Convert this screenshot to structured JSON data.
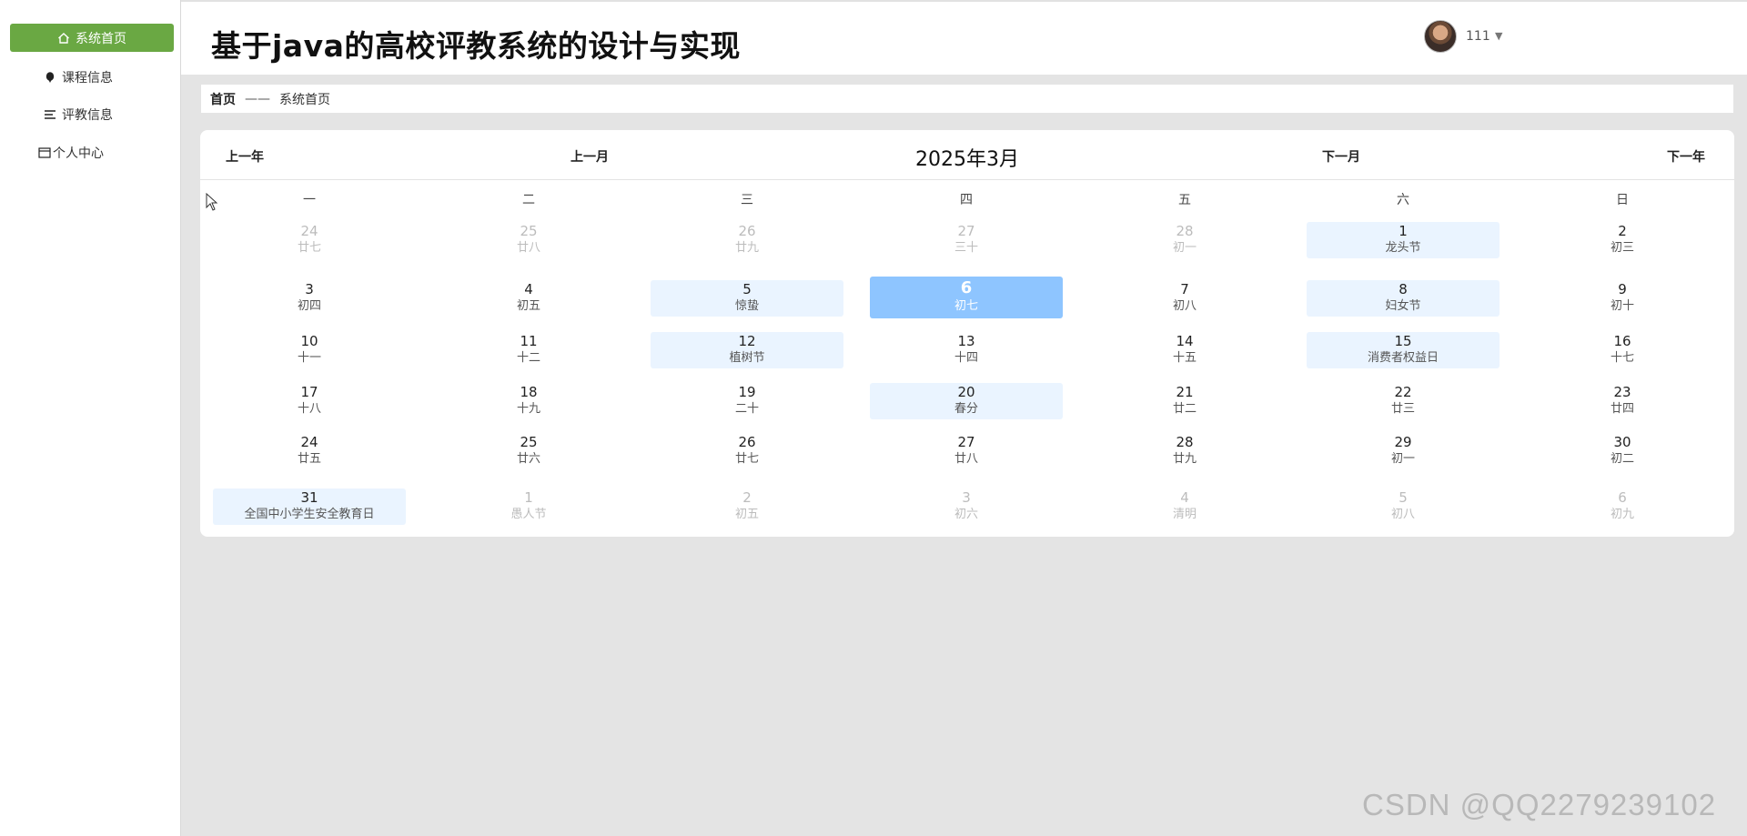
{
  "app": {
    "title": "基于java的高校评教系统的设计与实现"
  },
  "sidebar": {
    "items": [
      {
        "label": "系统首页",
        "icon": "home-icon"
      },
      {
        "label": "课程信息",
        "icon": "pin-icon"
      },
      {
        "label": "评教信息",
        "icon": "list-icon"
      },
      {
        "label": "个人中心",
        "icon": "card-icon"
      }
    ]
  },
  "header": {
    "username": "111",
    "caret": "▼"
  },
  "breadcrumb": {
    "home": "首页",
    "separator": "——",
    "current": "系统首页"
  },
  "calendar": {
    "prev_year": "上一年",
    "prev_month": "上一月",
    "title": "2025年3月",
    "next_month": "下一月",
    "next_year": "下一年",
    "weekdays": [
      "一",
      "二",
      "三",
      "四",
      "五",
      "六",
      "日"
    ],
    "weeks": [
      [
        {
          "d": "24",
          "l": "廿七",
          "type": "other"
        },
        {
          "d": "25",
          "l": "廿八",
          "type": "other"
        },
        {
          "d": "26",
          "l": "廿九",
          "type": "other"
        },
        {
          "d": "27",
          "l": "三十",
          "type": "other"
        },
        {
          "d": "28",
          "l": "初一",
          "type": "other"
        },
        {
          "d": "1",
          "l": "龙头节",
          "type": "fest"
        },
        {
          "d": "2",
          "l": "初三",
          "type": "normal"
        }
      ],
      [
        {
          "d": "3",
          "l": "初四",
          "type": "normal"
        },
        {
          "d": "4",
          "l": "初五",
          "type": "normal"
        },
        {
          "d": "5",
          "l": "惊蛰",
          "type": "fest"
        },
        {
          "d": "6",
          "l": "初七",
          "type": "today"
        },
        {
          "d": "7",
          "l": "初八",
          "type": "normal"
        },
        {
          "d": "8",
          "l": "妇女节",
          "type": "fest"
        },
        {
          "d": "9",
          "l": "初十",
          "type": "normal"
        }
      ],
      [
        {
          "d": "10",
          "l": "十一",
          "type": "normal"
        },
        {
          "d": "11",
          "l": "十二",
          "type": "normal"
        },
        {
          "d": "12",
          "l": "植树节",
          "type": "fest"
        },
        {
          "d": "13",
          "l": "十四",
          "type": "normal"
        },
        {
          "d": "14",
          "l": "十五",
          "type": "normal"
        },
        {
          "d": "15",
          "l": "消费者权益日",
          "type": "fest"
        },
        {
          "d": "16",
          "l": "十七",
          "type": "normal"
        }
      ],
      [
        {
          "d": "17",
          "l": "十八",
          "type": "normal"
        },
        {
          "d": "18",
          "l": "十九",
          "type": "normal"
        },
        {
          "d": "19",
          "l": "二十",
          "type": "normal"
        },
        {
          "d": "20",
          "l": "春分",
          "type": "fest"
        },
        {
          "d": "21",
          "l": "廿二",
          "type": "normal"
        },
        {
          "d": "22",
          "l": "廿三",
          "type": "normal"
        },
        {
          "d": "23",
          "l": "廿四",
          "type": "normal"
        }
      ],
      [
        {
          "d": "24",
          "l": "廿五",
          "type": "normal"
        },
        {
          "d": "25",
          "l": "廿六",
          "type": "normal"
        },
        {
          "d": "26",
          "l": "廿七",
          "type": "normal"
        },
        {
          "d": "27",
          "l": "廿八",
          "type": "normal"
        },
        {
          "d": "28",
          "l": "廿九",
          "type": "normal"
        },
        {
          "d": "29",
          "l": "初一",
          "type": "normal"
        },
        {
          "d": "30",
          "l": "初二",
          "type": "normal"
        }
      ],
      [
        {
          "d": "31",
          "l": "全国中小学生安全教育日",
          "type": "fest"
        },
        {
          "d": "1",
          "l": "愚人节",
          "type": "other"
        },
        {
          "d": "2",
          "l": "初五",
          "type": "other"
        },
        {
          "d": "3",
          "l": "初六",
          "type": "other"
        },
        {
          "d": "4",
          "l": "清明",
          "type": "other"
        },
        {
          "d": "5",
          "l": "初八",
          "type": "other"
        },
        {
          "d": "6",
          "l": "初九",
          "type": "other"
        }
      ]
    ]
  },
  "colors": {
    "active_nav": "#6aa843",
    "today": "#8ec5ff",
    "festival_bg": "#eaf4ff",
    "other_month": "#bcbcbc"
  },
  "watermark": "CSDN @QQ2279239102"
}
